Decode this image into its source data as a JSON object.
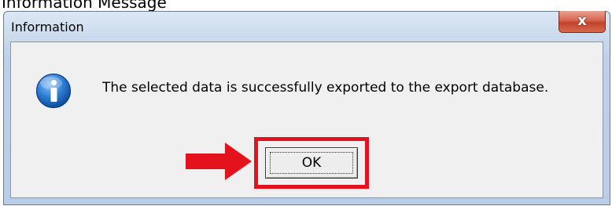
{
  "caption": {
    "text": "Information Message"
  },
  "dialog": {
    "title": "Information",
    "close_glyph": "x",
    "message": "The selected data is successfully exported to the export database.",
    "icon": "info-icon",
    "ok_label": "OK"
  },
  "annotation": {
    "highlight_color": "#e4121c",
    "arrow_color": "#e4121c",
    "arrow_icon": "right-arrow-icon"
  },
  "colors": {
    "titlebar": "#c7d8ec",
    "client": "#f0f0f0",
    "close_button": "#c2432b"
  }
}
